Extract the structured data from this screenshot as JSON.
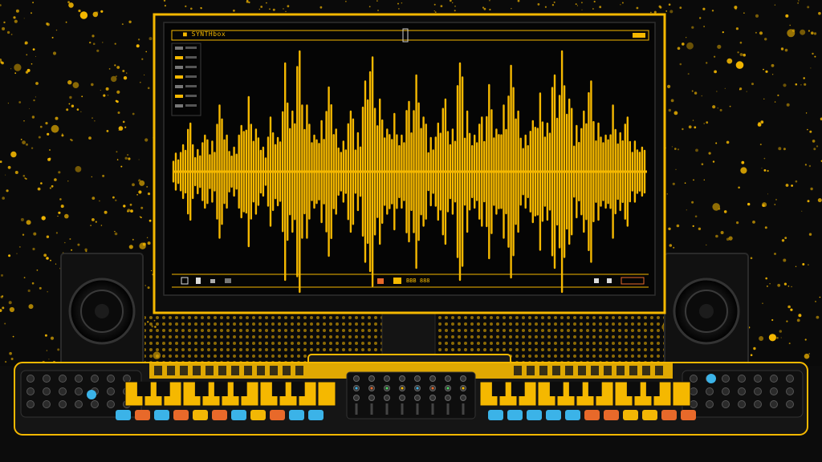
{
  "palette": {
    "background": "#0a0a0a",
    "accent": "#f5b800",
    "pad_orange": "#e8692a",
    "pad_blue": "#3bb3e8",
    "pad_yellow": "#f2b705"
  },
  "screen": {
    "title_text": "■ SYNTHbox",
    "status_text": "BBB 888"
  },
  "waveform": {
    "amplitudes": [
      0.15,
      0.22,
      0.4,
      0.18,
      0.3,
      0.25,
      0.55,
      0.3,
      0.2,
      0.38,
      0.62,
      0.35,
      0.2,
      0.45,
      0.28,
      0.9,
      0.5,
      1.0,
      0.55,
      0.3,
      0.42,
      0.7,
      0.35,
      0.25,
      0.5,
      0.32,
      0.75,
      0.95,
      0.6,
      0.35,
      0.48,
      0.3,
      0.58,
      0.8,
      0.45,
      0.28,
      0.4,
      0.6,
      0.35,
      0.9,
      0.5,
      0.3,
      0.45,
      0.72,
      0.35,
      0.55,
      0.88,
      0.5,
      0.3,
      0.42,
      0.65,
      0.4,
      0.8,
      1.0,
      0.6,
      0.38,
      0.5,
      0.75,
      0.4,
      0.3,
      0.55,
      0.32,
      0.45,
      0.25,
      0.2
    ]
  },
  "keyboards": [
    {
      "white_keys": 11
    },
    {
      "white_keys": 11
    }
  ],
  "pads": {
    "left": [
      "blue",
      "orange",
      "blue",
      "orange",
      "yellow",
      "orange",
      "blue",
      "yellow",
      "orange",
      "blue",
      "blue"
    ],
    "right": [
      "blue",
      "blue",
      "blue",
      "blue",
      "blue",
      "orange",
      "orange",
      "yellow",
      "yellow",
      "orange",
      "orange"
    ]
  }
}
